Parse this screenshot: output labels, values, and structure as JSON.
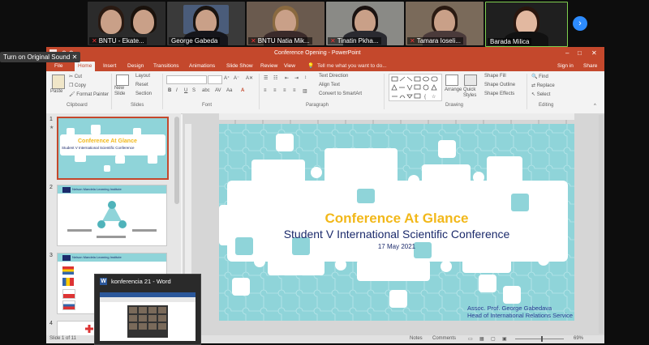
{
  "zoom": {
    "tooltip": "Turn on Original Sound",
    "participants": [
      {
        "name": "BNTU - Ekate...",
        "muted": true
      },
      {
        "name": "George Gabeda",
        "muted": false
      },
      {
        "name": "BNTU Natia Mik...",
        "muted": true
      },
      {
        "name": "Tinatin Pkha...",
        "muted": true
      },
      {
        "name": "Tamara Ioseli...",
        "muted": true
      },
      {
        "name": "Barada Milica",
        "muted": false
      }
    ],
    "next_icon": "›"
  },
  "ppt": {
    "window_title": "Conference Opening - PowerPoint",
    "tabs": [
      "File",
      "Home",
      "Insert",
      "Design",
      "Transitions",
      "Animations",
      "Slide Show",
      "Review",
      "View"
    ],
    "tell_me": "Tell me what you want to do...",
    "sign_in": "Sign in",
    "share": "Share",
    "ribbon": {
      "clipboard": {
        "paste": "Paste",
        "cut": "Cut",
        "copy": "Copy",
        "format_painter": "Format Painter",
        "label": "Clipboard"
      },
      "slides": {
        "new_slide": "New Slide",
        "layout": "Layout",
        "reset": "Reset",
        "section": "Section",
        "label": "Slides"
      },
      "font": {
        "label": "Font",
        "bold": "B",
        "italic": "I",
        "underline": "U",
        "strike": "S"
      },
      "paragraph": {
        "text_direction": "Text Direction",
        "align_text": "Align Text",
        "smartart": "Convert to SmartArt",
        "label": "Paragraph"
      },
      "drawing": {
        "arrange": "Arrange",
        "quick_styles": "Quick Styles",
        "shape_fill": "Shape Fill",
        "shape_outline": "Shape Outline",
        "shape_effects": "Shape Effects",
        "label": "Drawing"
      },
      "editing": {
        "find": "Find",
        "replace": "Replace",
        "select": "Select",
        "label": "Editing"
      }
    },
    "thumbnails": [
      {
        "num": "1",
        "title": "Conference At Glance",
        "subtitle": "Student V International Scientific Conference"
      },
      {
        "num": "2",
        "header": "Nelson Mandela Learning Institute"
      },
      {
        "num": "3",
        "header": "Nelson Mandela Learning Institute"
      },
      {
        "num": "4"
      }
    ],
    "slide": {
      "title": "Conference At Glance",
      "subtitle": "Student V International Scientific Conference",
      "date": "17 May 2021",
      "presenter": "Assoc. Prof. George Gabedava",
      "role": "Head of International Relations Service"
    },
    "status": {
      "slide_count": "Slide 1 of 11",
      "notes": "Notes",
      "comments": "Comments",
      "zoom": "69%"
    }
  },
  "word_popup": {
    "title": "konferencia 21 - Word",
    "icon": "W"
  },
  "colors": {
    "ppt_red": "#c4482c",
    "puzzle": "#8fd4d9",
    "title_yellow": "#f2b81a",
    "title_navy": "#1b2a6b",
    "presenter_blue": "#2b3b92",
    "zoom_blue": "#2d8cff"
  }
}
